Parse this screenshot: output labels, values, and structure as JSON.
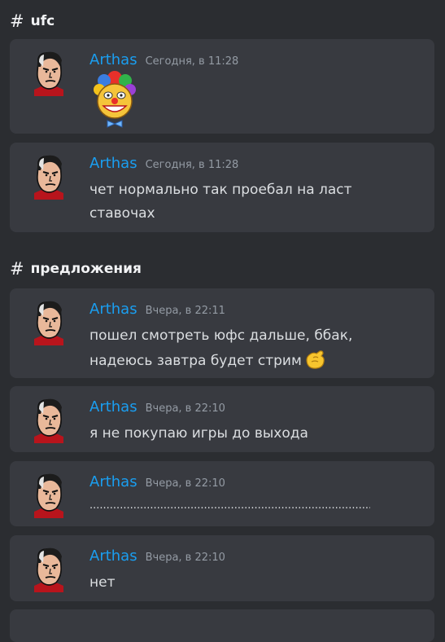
{
  "sections": [
    {
      "channel": "ufc",
      "messages": [
        {
          "author": "Arthas",
          "time": "Сегодня, в 11:28",
          "text": ""
        },
        {
          "author": "Arthas",
          "time": "Сегодня, в 11:28",
          "text": "чет нормально так проебал на ласт ставочах"
        }
      ]
    },
    {
      "channel": "предложения",
      "messages": [
        {
          "author": "Arthas",
          "time": "Вчера, в 22:11",
          "text": "пошел смотреть юфс дальше, ббак, надеюсь завтра будет стрим"
        },
        {
          "author": "Arthas",
          "time": "Вчера, в 22:10",
          "text": "я не покупаю игры до выхода"
        },
        {
          "author": "Arthas",
          "time": "Вчера, в 22:10",
          "text": "........................................................................................."
        },
        {
          "author": "Arthas",
          "time": "Вчера, в 22:10",
          "text": "нет"
        }
      ]
    }
  ],
  "icons": {
    "avatar": "arthas-avatar",
    "sticker": "clown-sticker",
    "inline_emoji": "pinched-hand-emoji"
  },
  "colors": {
    "background": "#2b2d31",
    "card": "#383a40",
    "author": "#1a9ef0",
    "timestamp": "#949ba4",
    "text": "#dbdee1"
  }
}
